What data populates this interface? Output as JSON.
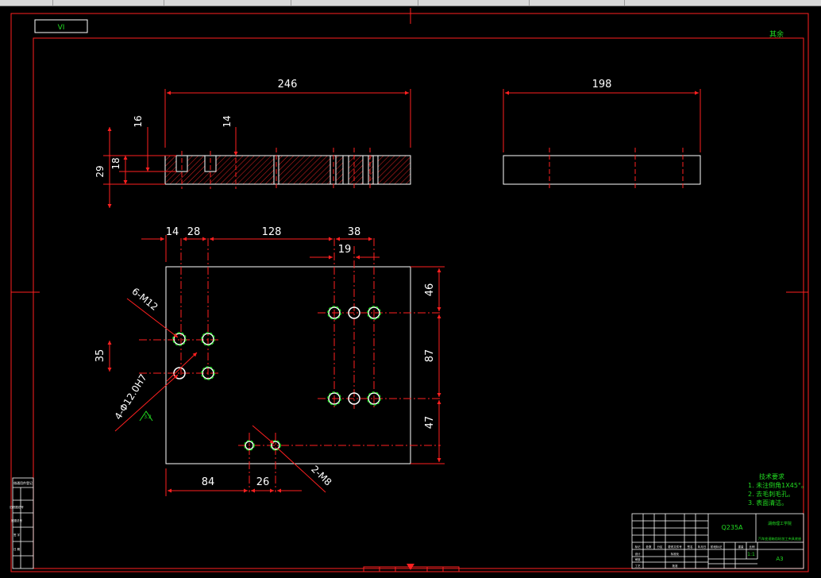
{
  "topbar": {
    "segments": 7
  },
  "drawing": {
    "view_tag": "ⅤⅠ",
    "roughness_note": "其余",
    "top_view": {
      "overall_width": "246",
      "height_total": "29",
      "pocket_depth": "18",
      "top_offset": "16",
      "counterbore": "14"
    },
    "side_view": {
      "overall_width": "198"
    },
    "plan_view": {
      "dims_top": [
        "14",
        "28",
        "128",
        "38"
      ],
      "dim_19": "19",
      "dims_right": [
        "46",
        "87",
        "47"
      ],
      "dim_left": "35",
      "dims_bottom": [
        "84",
        "26"
      ],
      "callout_m12": "6-M12",
      "callout_phi": "4-Φ12.0H7",
      "callout_m8": "2-M8",
      "roughness_symbol": "3.2"
    },
    "tech_requirements": {
      "title": "技术要求",
      "items": [
        "1. 未注倒角1X45°。",
        "2. 去毛刺毛孔。",
        "3. 表面清洁。"
      ]
    },
    "title_block": {
      "material": "Q235A",
      "school": "湖南理工学院",
      "part_name": "汽车变速箱齿轮加工夹具底座",
      "scale": "1:1",
      "sheet": "A3",
      "row_labels": [
        "标记",
        "处数",
        "分区",
        "更改文件号",
        "签名",
        "年月日"
      ],
      "side_labels": [
        "设计",
        "审核",
        "工艺",
        "标准化",
        "批准"
      ],
      "stage": "阶段标记",
      "weight": "重量",
      "ratio": "比例"
    },
    "left_stamp_labels": [
      "借通用件登记",
      "旧底图总号",
      "底图总号",
      "签 字",
      "日 期"
    ]
  }
}
